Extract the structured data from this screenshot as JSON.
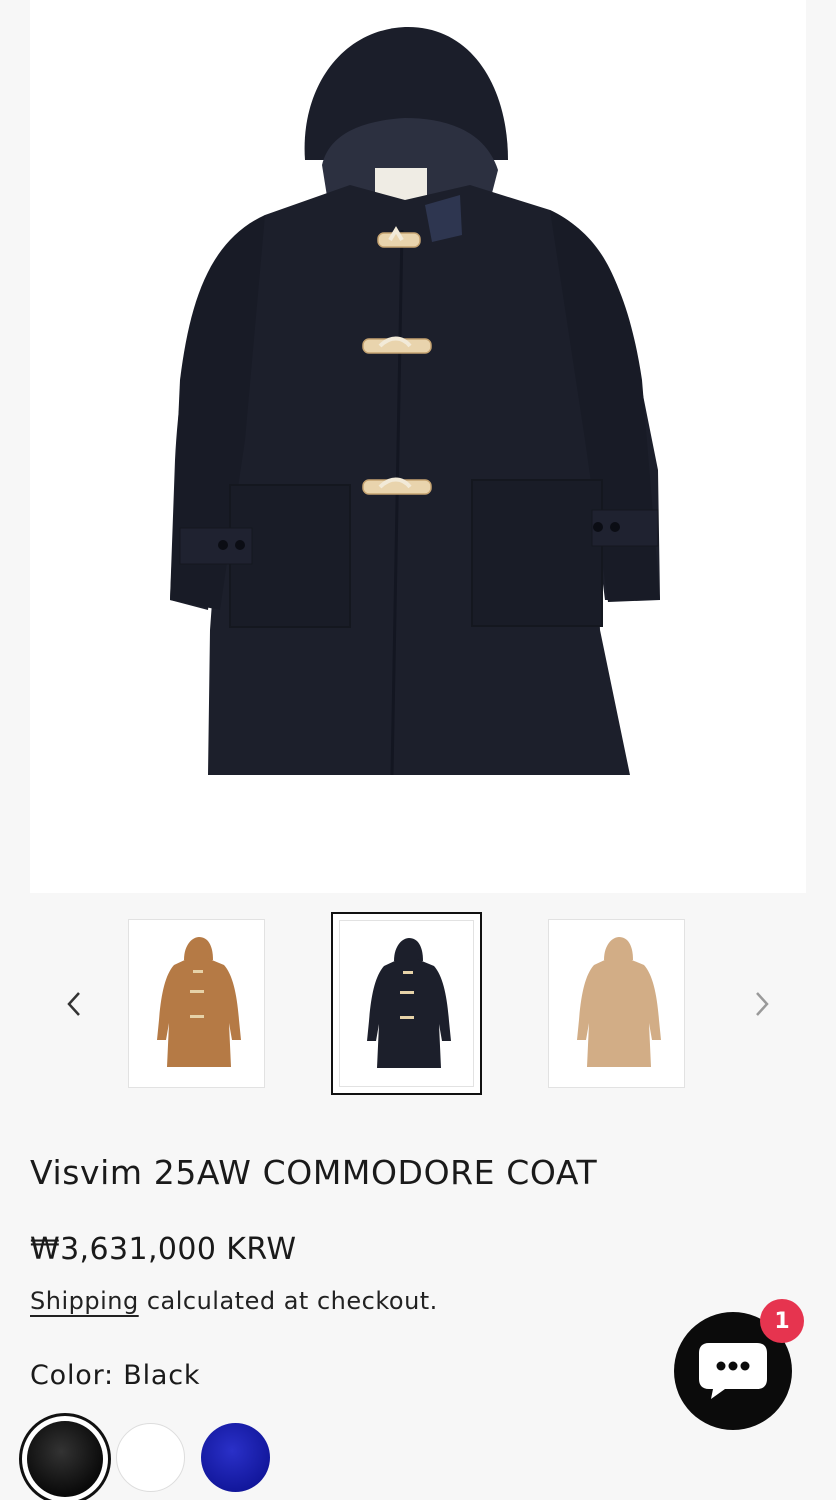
{
  "product": {
    "title": "Visvim 25AW COMMODORE COAT",
    "price": "₩3,631,000 KRW",
    "shipping_link": "Shipping",
    "shipping_rest": " calculated at checkout.",
    "color_label": "Color: Black"
  },
  "gallery": {
    "main_image_alt": "navy hooded duffle coat with toggle buttons",
    "thumbnails": [
      {
        "color": "#b57a45",
        "selected": false
      },
      {
        "color": "#1c1f2b",
        "selected": true
      },
      {
        "color": "#d2ad86",
        "selected": false
      }
    ]
  },
  "swatches": [
    {
      "name": "Black",
      "color": "#0a0a0a",
      "selected": true
    },
    {
      "name": "White",
      "color": "#ffffff",
      "selected": false
    },
    {
      "name": "Blue",
      "color": "#11169a",
      "selected": false
    }
  ],
  "chat": {
    "badge_count": "1"
  },
  "colors": {
    "coat_navy": "#1c1f2b",
    "badge_red": "#e6344f",
    "background": "#f7f7f7"
  }
}
